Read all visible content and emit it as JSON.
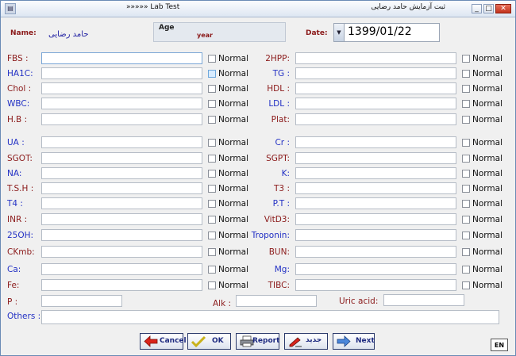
{
  "window": {
    "title_left": "»»»»» Lab Test",
    "title_right": "ثبت آزمایش حامد رضایی",
    "minimize": "_",
    "maximize": "□",
    "close": "✕"
  },
  "header": {
    "name_label": "Name:",
    "name_value": "حامد رضایی",
    "age_label": "Age",
    "age_unit": "year",
    "date_label": "Date:",
    "date_value": "1399/01/22"
  },
  "checkbox_label": "Normal",
  "fields_left": [
    {
      "label": "FBS :",
      "color": "red"
    },
    {
      "label": "HA1C:",
      "color": "blue"
    },
    {
      "label": "Chol :",
      "color": "red"
    },
    {
      "label": "WBC:",
      "color": "blue"
    },
    {
      "label": "H.B :",
      "color": "red"
    },
    {
      "label": "UA :",
      "color": "blue"
    },
    {
      "label": "SGOT:",
      "color": "red"
    },
    {
      "label": "NA:",
      "color": "blue"
    },
    {
      "label": "T.S.H :",
      "color": "red"
    },
    {
      "label": "T4 :",
      "color": "blue"
    },
    {
      "label": "INR :",
      "color": "red"
    },
    {
      "label": "25OH:",
      "color": "blue"
    },
    {
      "label": "CKmb:",
      "color": "red"
    },
    {
      "label": "Ca:",
      "color": "blue"
    },
    {
      "label": "Fe:",
      "color": "red"
    }
  ],
  "fields_right": [
    {
      "label": "2HPP:",
      "color": "red"
    },
    {
      "label": "TG :",
      "color": "blue"
    },
    {
      "label": "HDL :",
      "color": "red"
    },
    {
      "label": "LDL :",
      "color": "blue"
    },
    {
      "label": "Plat:",
      "color": "red"
    },
    {
      "label": "Cr :",
      "color": "blue"
    },
    {
      "label": "SGPT:",
      "color": "red"
    },
    {
      "label": "K:",
      "color": "blue"
    },
    {
      "label": "T3 :",
      "color": "red"
    },
    {
      "label": "P.T :",
      "color": "blue"
    },
    {
      "label": "VitD3:",
      "color": "red"
    },
    {
      "label": "Troponin:",
      "color": "blue"
    },
    {
      "label": "BUN:",
      "color": "red"
    },
    {
      "label": "Mg:",
      "color": "blue"
    },
    {
      "label": "TIBC:",
      "color": "red"
    }
  ],
  "bottom_fields": {
    "p_label": "P :",
    "alk_label": "Alk :",
    "uric_label": "Uric acid:",
    "others_label": "Others :"
  },
  "buttons": {
    "cancel": "Cancel",
    "ok": "OK",
    "report": "Report",
    "new": "جدید",
    "next": "Next",
    "lang": "EN"
  },
  "colors": {
    "red_label": "#8b1a1a",
    "blue_label": "#2230c4",
    "button_text": "#1d2a80"
  }
}
